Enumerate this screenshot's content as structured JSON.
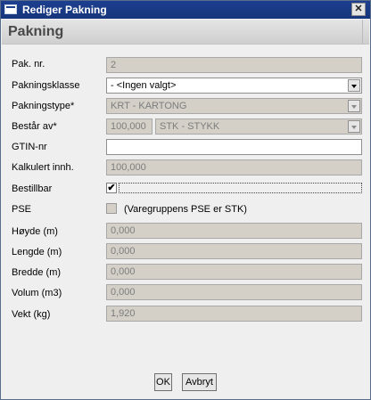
{
  "window": {
    "title": "Rediger Pakning",
    "close_glyph": "✕"
  },
  "header": {
    "title": "Pakning"
  },
  "form": {
    "pak_nr": {
      "label": "Pak. nr.",
      "value": "2"
    },
    "pakningsklasse": {
      "label": "Pakningsklasse",
      "value": "- <Ingen valgt>"
    },
    "pakningstype": {
      "label": "Pakningstype*",
      "value": "KRT - KARTONG"
    },
    "bestar_av": {
      "label": "Består av*",
      "quantity": "100,000",
      "unit": "STK - STYKK"
    },
    "gtin": {
      "label": "GTIN-nr",
      "value": ""
    },
    "kalkulert": {
      "label": "Kalkulert innh.",
      "value": "100,000"
    },
    "bestillbar": {
      "label": "Bestillbar",
      "checked": true,
      "check_glyph": "✔"
    },
    "pse": {
      "label": "PSE",
      "checked": false,
      "note": "(Varegruppens PSE er STK)"
    },
    "hoyde": {
      "label": "Høyde (m)",
      "value": "0,000"
    },
    "lengde": {
      "label": "Lengde (m)",
      "value": "0,000"
    },
    "bredde": {
      "label": "Bredde (m)",
      "value": "0,000"
    },
    "volum": {
      "label": "Volum (m3)",
      "value": "0,000"
    },
    "vekt": {
      "label": "Vekt (kg)",
      "value": "1,920"
    }
  },
  "buttons": {
    "ok": "OK",
    "cancel": "Avbryt"
  }
}
